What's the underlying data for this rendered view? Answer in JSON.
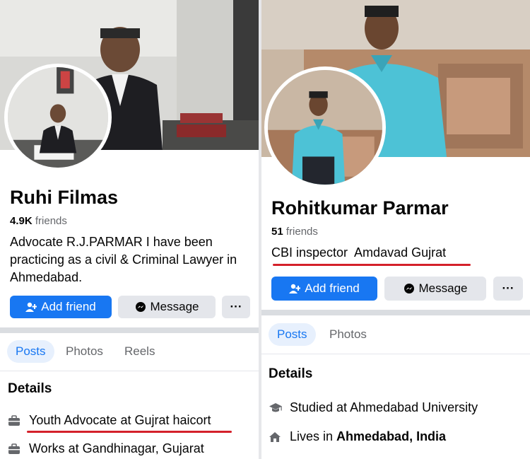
{
  "left_profile": {
    "name": "Ruhi Filmas",
    "friends_count": "4.9K",
    "friends_word": "friends",
    "bio": "Advocate R.J.PARMAR I have been practicing as a civil & Criminal Lawyer in Ahmedabad.",
    "add_friend_label": "Add friend",
    "message_label": "Message",
    "more_label": "···",
    "tabs": [
      "Posts",
      "Photos",
      "Reels"
    ],
    "details_title": "Details",
    "details": [
      {
        "icon": "briefcase-icon",
        "text": "Youth Advocate at Gujrat haicort"
      },
      {
        "icon": "briefcase-icon",
        "text": "Works at Gandhinagar, Gujarat"
      }
    ]
  },
  "right_profile": {
    "name": "Rohitkumar Parmar",
    "friends_count": "51",
    "friends_word": "friends",
    "bio": "CBI inspector  Amdavad Gujrat",
    "add_friend_label": "Add friend",
    "message_label": "Message",
    "more_label": "···",
    "tabs": [
      "Posts",
      "Photos"
    ],
    "details_title": "Details",
    "details": [
      {
        "icon": "graduation-cap-icon",
        "text": "Studied at Ahmedabad University"
      },
      {
        "icon": "home-icon",
        "prefix": "Lives in ",
        "bold": "Ahmedabad, India"
      }
    ]
  },
  "colors": {
    "primary_blue": "#1877f2",
    "annotation_red": "#d4202a",
    "secondary_button": "#e4e6eb"
  }
}
